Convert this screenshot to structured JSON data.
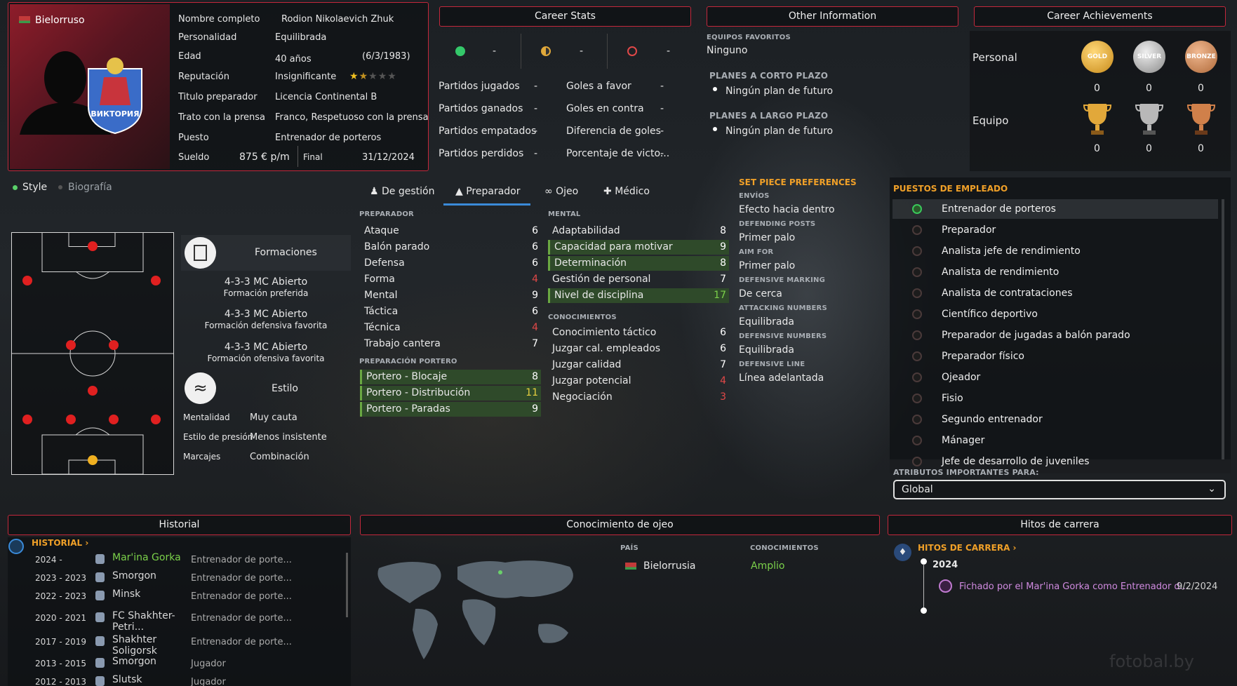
{
  "profile": {
    "nationality": "Bielorruso",
    "fields": [
      {
        "label": "Nombre completo",
        "value": "Rodion Nikolaevich Zhuk"
      },
      {
        "label": "Personalidad",
        "value": "Equilibrada"
      },
      {
        "label": "Edad",
        "value": "40 años",
        "extra": "(6/3/1983)"
      },
      {
        "label": "Reputación",
        "value": "Insignificante",
        "stars": 1.5
      },
      {
        "label": "Titulo preparador",
        "value": "Licencia Continental B"
      },
      {
        "label": "Trato con la prensa",
        "value": "Franco, Respetuoso con la prensa"
      },
      {
        "label": "Puesto",
        "value": "Entrenador de porteros"
      }
    ],
    "salary_label": "Sueldo",
    "salary": "875 € p/m",
    "end_label": "Final",
    "end_date": "31/12/2024",
    "club_logo_text": "ВИКТОРИЯ"
  },
  "career_stats": {
    "title": "Career Stats",
    "icons": [
      "-",
      "-",
      "-"
    ],
    "left": [
      {
        "l": "Partidos jugados",
        "v": "-"
      },
      {
        "l": "Partidos ganados",
        "v": "-"
      },
      {
        "l": "Partidos empatados",
        "v": "-"
      },
      {
        "l": "Partidos perdidos",
        "v": "-"
      }
    ],
    "right": [
      {
        "l": "Goles a favor",
        "v": "-"
      },
      {
        "l": "Goles en contra",
        "v": "-"
      },
      {
        "l": "Diferencia de goles",
        "v": "-"
      },
      {
        "l": "Porcentaje de victo...",
        "v": "-"
      }
    ]
  },
  "other_info": {
    "title": "Other Information",
    "fav_label": "EQUIPOS FAVORITOS",
    "fav": "Ninguno",
    "short_label": "PLANES A CORTO PLAZO",
    "short": "Ningún plan de futuro",
    "long_label": "PLANES A LARGO PLAZO",
    "long": "Ningún plan de futuro"
  },
  "achievements": {
    "title": "Career Achievements",
    "personal": "Personal",
    "team": "Equipo",
    "medals": [
      "GOLD",
      "SILVER",
      "BRONZE"
    ],
    "personal_counts": [
      "0",
      "0",
      "0"
    ],
    "team_counts": [
      "0",
      "0",
      "0"
    ]
  },
  "style_tabs": {
    "style": "Style",
    "bio": "Biografía"
  },
  "formations": {
    "title": "Formaciones",
    "items": [
      {
        "f": "4-3-3 MC Abierto",
        "d": "Formación preferida"
      },
      {
        "f": "4-3-3 MC Abierto",
        "d": "Formación defensiva favorita"
      },
      {
        "f": "4-3-3 MC Abierto",
        "d": "Formación ofensiva favorita"
      }
    ],
    "style_title": "Estilo",
    "style_rows": [
      {
        "l": "Mentalidad",
        "v": "Muy cauta"
      },
      {
        "l": "Estilo de presión",
        "v": "Menos insistente"
      },
      {
        "l": "Marcajes",
        "v": "Combinación"
      }
    ]
  },
  "attr_tabs": [
    "De gestión",
    "Preparador",
    "Ojeo",
    "Médico"
  ],
  "preparador": {
    "label": "PREPARADOR",
    "rows": [
      {
        "l": "Ataque",
        "v": "6",
        "c": "w"
      },
      {
        "l": "Balón parado",
        "v": "6",
        "c": "w"
      },
      {
        "l": "Defensa",
        "v": "6",
        "c": "w"
      },
      {
        "l": "Forma",
        "v": "4",
        "c": "r"
      },
      {
        "l": "Mental",
        "v": "9",
        "c": "w"
      },
      {
        "l": "Táctica",
        "v": "6",
        "c": "w"
      },
      {
        "l": "Técnica",
        "v": "4",
        "c": "r"
      },
      {
        "l": "Trabajo cantera",
        "v": "7",
        "c": "w"
      }
    ],
    "gk_label": "PREPARACIÓN PORTERO",
    "gk": [
      {
        "l": "Portero - Blocaje",
        "v": "8",
        "c": "w"
      },
      {
        "l": "Portero - Distribución",
        "v": "11",
        "c": "y"
      },
      {
        "l": "Portero - Paradas",
        "v": "9",
        "c": "w"
      }
    ]
  },
  "mental": {
    "label": "MENTAL",
    "rows": [
      {
        "l": "Adaptabilidad",
        "v": "8",
        "c": "w",
        "h": false
      },
      {
        "l": "Capacidad para motivar",
        "v": "9",
        "c": "w",
        "h": true
      },
      {
        "l": "Determinación",
        "v": "8",
        "c": "w",
        "h": true
      },
      {
        "l": "Gestión de personal",
        "v": "7",
        "c": "w",
        "h": false
      },
      {
        "l": "Nivel de disciplina",
        "v": "17",
        "c": "g",
        "h": true
      }
    ],
    "know_label": "CONOCIMIENTOS",
    "know": [
      {
        "l": "Conocimiento táctico",
        "v": "6",
        "c": "w"
      },
      {
        "l": "Juzgar cal. empleados",
        "v": "6",
        "c": "w"
      },
      {
        "l": "Juzgar calidad",
        "v": "7",
        "c": "w"
      },
      {
        "l": "Juzgar potencial",
        "v": "4",
        "c": "r"
      },
      {
        "l": "Negociación",
        "v": "3",
        "c": "r"
      }
    ]
  },
  "set_piece": {
    "title": "SET PIECE PREFERENCES",
    "items": [
      {
        "l": "ENVÍOS",
        "v": "Efecto hacia dentro"
      },
      {
        "l": "DEFENDING POSTS",
        "v": "Primer palo"
      },
      {
        "l": "AIM FOR",
        "v": "Primer palo"
      },
      {
        "l": "DEFENSIVE MARKING",
        "v": "De cerca"
      },
      {
        "l": "ATTACKING NUMBERS",
        "v": "Equilibrada"
      },
      {
        "l": "DEFENSIVE NUMBERS",
        "v": "Equilibrada"
      },
      {
        "l": "DEFENSIVE LINE",
        "v": "Línea adelantada"
      }
    ]
  },
  "roles": {
    "title": "PUESTOS DE EMPLEADO",
    "items": [
      "Entrenador de porteros",
      "Preparador",
      "Analista jefe de rendimiento",
      "Analista de rendimiento",
      "Analista de contrataciones",
      "Científico deportivo",
      "Preparador de jugadas a balón parado",
      "Preparador físico",
      "Ojeador",
      "Fisio",
      "Segundo entrenador",
      "Mánager",
      "Jefe de desarrollo de juveniles"
    ],
    "attr_label": "ATRIBUTOS IMPORTANTES PARA:",
    "select": "Global"
  },
  "history": {
    "title": "Historial",
    "link": "HISTORIAL",
    "rows": [
      {
        "y": "2024 -",
        "c": "Mar'ina Gorka",
        "r": "Entrenador de porte..."
      },
      {
        "y": "2023 - 2023",
        "c": "Smorgon",
        "r": "Entrenador de porte..."
      },
      {
        "y": "2022 - 2023",
        "c": "Minsk",
        "r": "Entrenador de porte..."
      },
      {
        "y": "2020 - 2021",
        "c": "FC Shakhter-Petri...",
        "r": "Entrenador de porte..."
      },
      {
        "y": "2017 - 2019",
        "c": "Shakhter Soligorsk",
        "r": "Entrenador de porte..."
      },
      {
        "y": "2013 - 2015",
        "c": "Smorgon",
        "r": "Jugador"
      },
      {
        "y": "2012 - 2013",
        "c": "Slutsk",
        "r": "Jugador"
      }
    ]
  },
  "scout": {
    "title": "Conocimiento de ojeo",
    "country_label": "PAÍS",
    "know_label": "CONOCIMIENTOS",
    "country": "Bielorrusia",
    "level": "Amplio"
  },
  "milestones": {
    "title": "Hitos de carrera",
    "link": "HITOS DE CARRERA",
    "year": "2024",
    "text": "Fichado por el Mar'ina Gorka como Entrenador d...",
    "date": "9/2/2024"
  },
  "watermark": "fotobal.by",
  "colors": {
    "accent": "#c3283c",
    "orange": "#f0a028",
    "green": "#7bd14a"
  }
}
